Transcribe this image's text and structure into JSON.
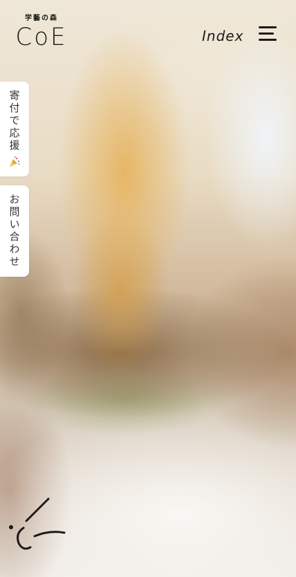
{
  "logo": {
    "subtitle": "学藝の森",
    "title": "CoE"
  },
  "nav": {
    "index_label": "Index",
    "menu_icon": "hamburger-menu-icon"
  },
  "side_tabs": {
    "donate_label": "寄付で応援",
    "donate_icon": "party-popper-icon",
    "contact_label": "お問い合わせ"
  },
  "decoration": {
    "doodle_icon": "smile-doodle-icon"
  },
  "colors": {
    "ink": "#1a1a1a",
    "tab_background": "#ffffff",
    "photo_amber": "#e6b45f"
  }
}
